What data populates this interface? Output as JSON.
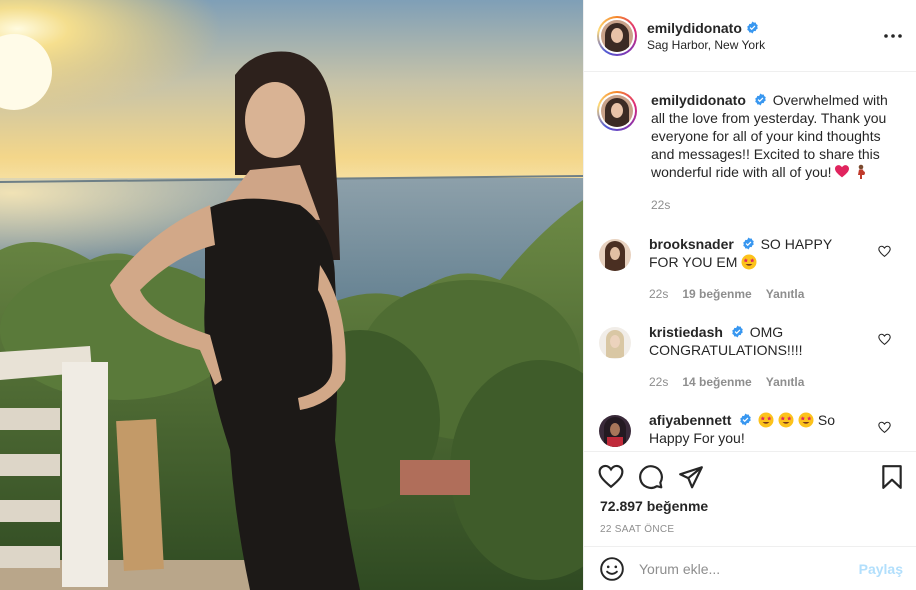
{
  "post": {
    "author": {
      "username": "emilydidonato",
      "location": "Sag Harbor, New York",
      "verified": true
    },
    "caption": {
      "username": "emilydidonato",
      "text": "Overwhelmed with all the love from yesterday. Thank you everyone for all of your kind thoughts and messages!! Excited to share this wonderful ride with all of you!",
      "emojis": [
        "red-heart",
        "pregnant-woman"
      ],
      "time": "22s"
    },
    "comments": [
      {
        "username": "brooksnader",
        "text": "SO HAPPY FOR YOU EM",
        "emoji_after": "star-struck",
        "time": "22s",
        "likes": "19 beğenme",
        "reply": "Yanıtla"
      },
      {
        "username": "kristiedash",
        "text": "OMG CONGRATULATIONS!!!!",
        "time": "22s",
        "likes": "14 beğenme",
        "reply": "Yanıtla"
      },
      {
        "username": "afiyabennett",
        "emoji_before_count": 3,
        "text": "So Happy For you!",
        "emoji": "star-struck"
      }
    ],
    "likes_count": "72.897 beğenme",
    "timestamp": "22 SAAT ÖNCE",
    "add_comment": {
      "placeholder": "Yorum ekle...",
      "post_label": "Paylaş"
    }
  },
  "colors": {
    "verified": "#3897f0",
    "muted": "#8e8e8e",
    "post_disabled": "#b2dffc",
    "heart_red": "#e0245e"
  }
}
